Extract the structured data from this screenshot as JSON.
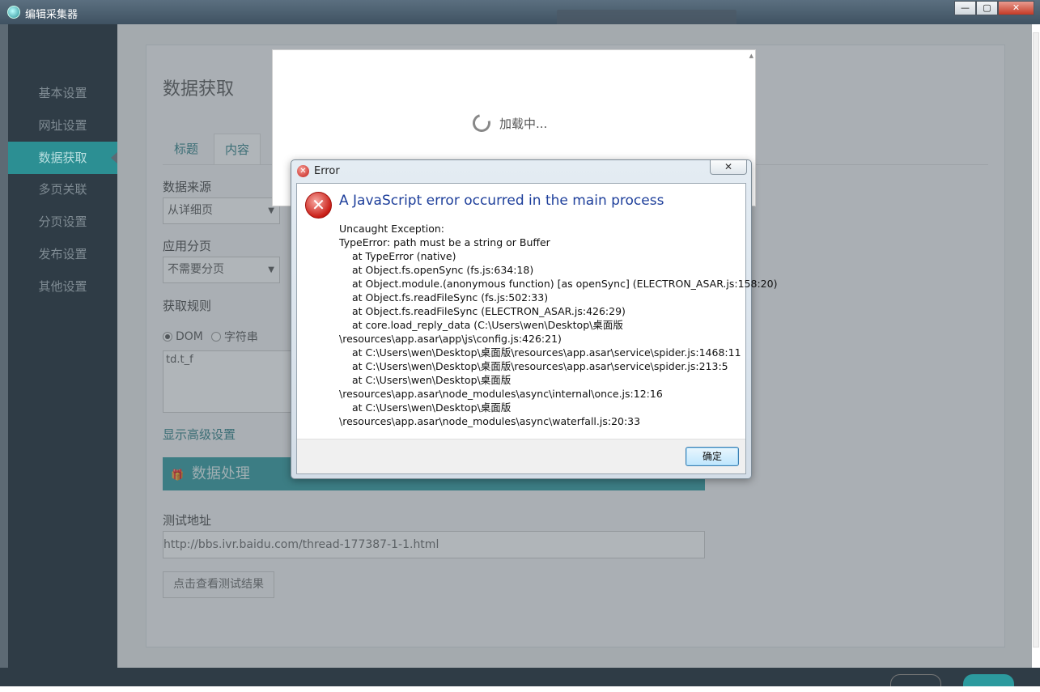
{
  "window": {
    "title": "编辑采集器"
  },
  "sidebar": {
    "items": [
      {
        "label": "基本设置"
      },
      {
        "label": "网址设置"
      },
      {
        "label": "数据获取"
      },
      {
        "label": "多页关联"
      },
      {
        "label": "分页设置"
      },
      {
        "label": "发布设置"
      },
      {
        "label": "其他设置"
      }
    ],
    "active_index": 2
  },
  "main": {
    "page_title": "数据获取",
    "tabs": [
      {
        "label": "标题"
      },
      {
        "label": "内容"
      }
    ],
    "data_source_label": "数据来源",
    "data_source_value": "从详细页",
    "apply_paging_label": "应用分页",
    "apply_paging_value": "不需要分页",
    "rule_label": "获取规则",
    "rule_options": [
      {
        "label": "DOM",
        "checked": true
      },
      {
        "label": "字符串",
        "checked": false
      }
    ],
    "rule_value": "td.t_f",
    "advanced_link": "显示高级设置",
    "section_title": "数据处理",
    "test_url_label": "测试地址",
    "test_url_value": "http://bbs.ivr.baidu.com/thread-177387-1-1.html",
    "test_button": "点击查看测试结果"
  },
  "loading": {
    "text": "加载中..."
  },
  "error_dialog": {
    "title": "Error",
    "close_label": "✕",
    "heading": "A JavaScript error occurred in the main process",
    "lines": [
      "Uncaught Exception:",
      "TypeError: path must be a string or Buffer",
      "at TypeError (native)",
      "at Object.fs.openSync (fs.js:634:18)",
      "at Object.module.(anonymous function) [as openSync] (ELECTRON_ASAR.js:158:20)",
      "at Object.fs.readFileSync (fs.js:502:33)",
      "at Object.fs.readFileSync (ELECTRON_ASAR.js:426:29)",
      "at core.load_reply_data (C:\\Users\\wen\\Desktop\\桌面版",
      "\\resources\\app.asar\\app\\js\\config.js:426:21)",
      "at C:\\Users\\wen\\Desktop\\桌面版\\resources\\app.asar\\service\\spider.js:1468:11",
      "at C:\\Users\\wen\\Desktop\\桌面版\\resources\\app.asar\\service\\spider.js:213:5",
      "at C:\\Users\\wen\\Desktop\\桌面版",
      "\\resources\\app.asar\\node_modules\\async\\internal\\once.js:12:16",
      "at C:\\Users\\wen\\Desktop\\桌面版",
      "\\resources\\app.asar\\node_modules\\async\\waterfall.js:20:33"
    ],
    "ok_button": "确定"
  }
}
